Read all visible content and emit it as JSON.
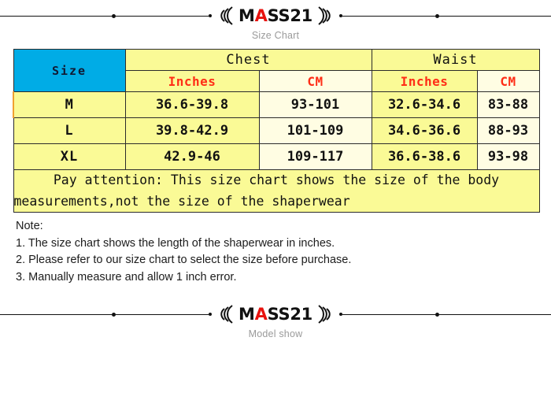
{
  "brand": {
    "name_prefix": "M",
    "name_accent": "A",
    "name_suffix": "SS21",
    "accent_color": "#e8120e",
    "top_caption": "Size Chart",
    "bottom_caption": "Model show"
  },
  "table": {
    "size_header": "Size",
    "groups": [
      {
        "label": "Chest"
      },
      {
        "label": "Waist"
      }
    ],
    "units": [
      "Inches",
      "CM",
      "Inches",
      "CM"
    ],
    "unit_color": "#ff2d16",
    "size_header_bg": "#00ace6",
    "inch_cell_bg": "#fafa96",
    "cm_cell_bg": "#fffde3",
    "rows": [
      {
        "size": "M",
        "chest_in": "36.6-39.8",
        "chest_cm": "93-101",
        "waist_in": "32.6-34.6",
        "waist_cm": "83-88"
      },
      {
        "size": "L",
        "chest_in": "39.8-42.9",
        "chest_cm": "101-109",
        "waist_in": "34.6-36.6",
        "waist_cm": "88-93"
      },
      {
        "size": "XL",
        "chest_in": "42.9-46",
        "chest_cm": "109-117",
        "waist_in": "36.6-38.6",
        "waist_cm": "93-98"
      }
    ],
    "attention": "Pay attention: This size chart shows the size of the body measurements,not the size of the shaperwear"
  },
  "note": {
    "title": "Note:",
    "items": [
      "1. The size chart shows the length of the shaperwear in inches.",
      "2. Please refer to our size chart to select the size before purchase.",
      "3. Manually measure and allow 1 inch error."
    ]
  }
}
